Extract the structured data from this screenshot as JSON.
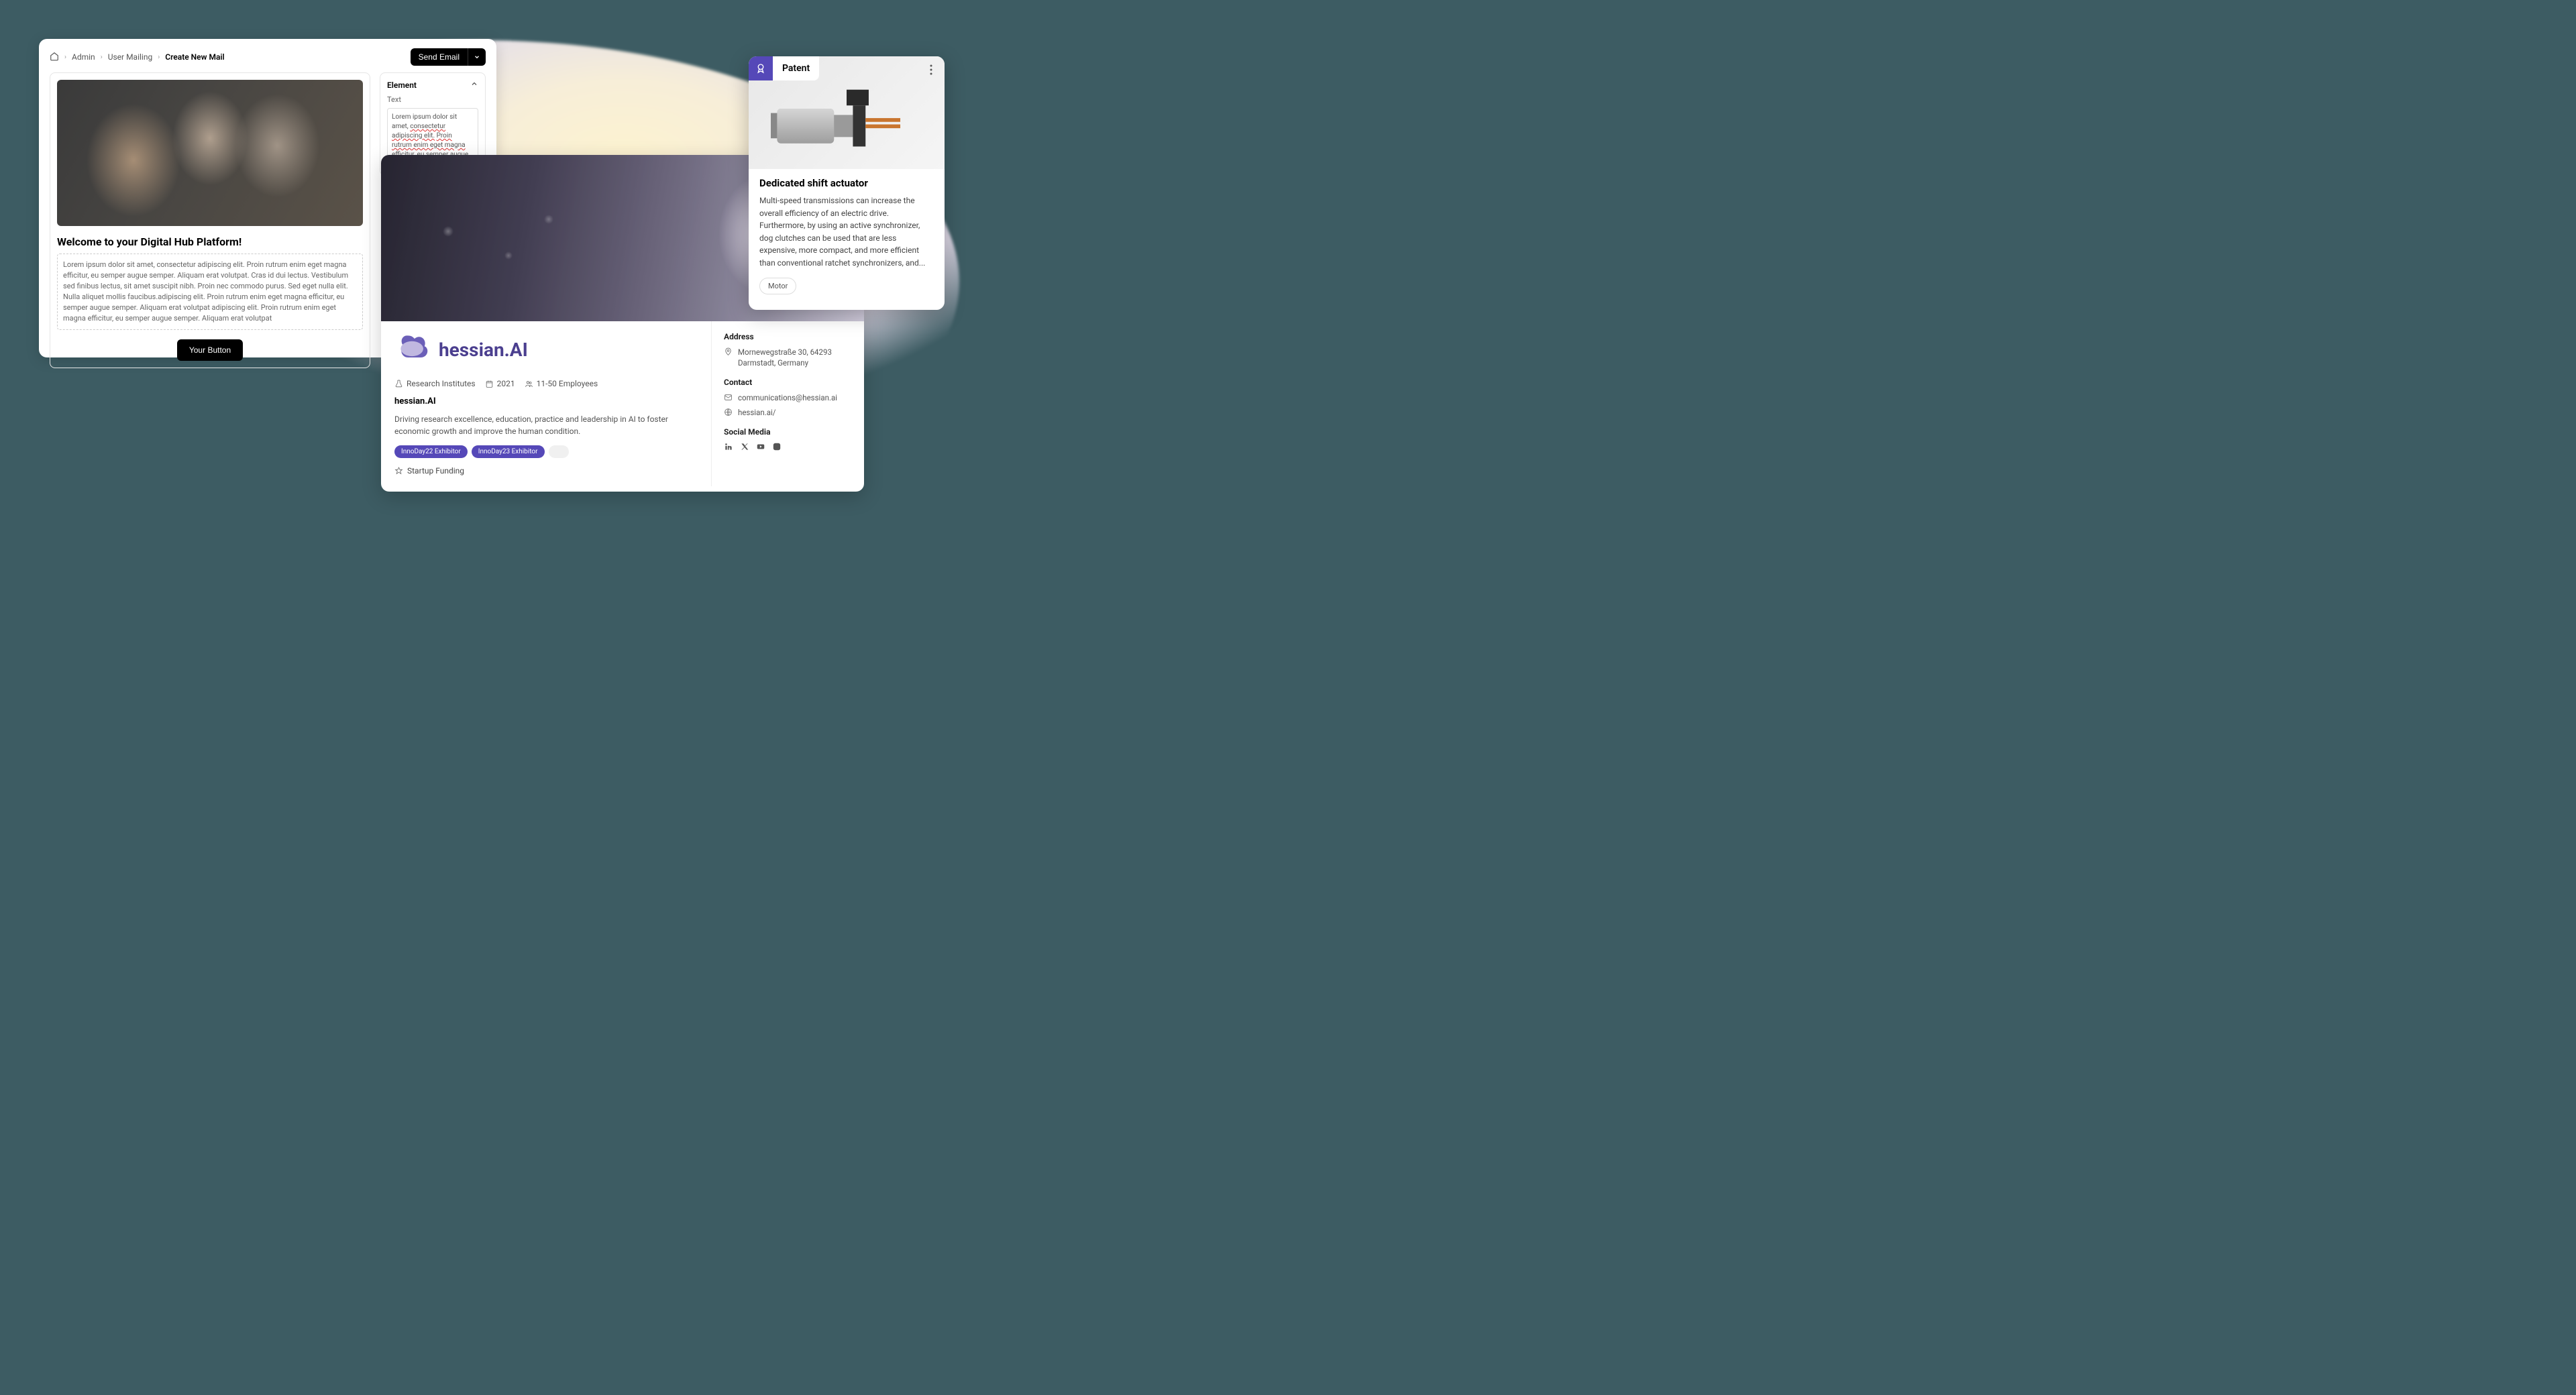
{
  "editor": {
    "breadcrumb": {
      "items": [
        "Admin",
        "User Mailing"
      ],
      "current": "Create New Mail"
    },
    "send_label": "Send Email",
    "heading": "Welcome to your Digital Hub Platform!",
    "body_text": "Lorem ipsum dolor sit amet, consectetur adipiscing elit. Proin rutrum enim eget magna efficitur, eu semper augue semper. Aliquam erat volutpat. Cras id dui lectus. Vestibulum sed finibus lectus, sit amet suscipit nibh. Proin nec commodo purus. Sed eget nulla elit. Nulla aliquet mollis faucibus.adipiscing elit. Proin rutrum enim eget magna efficitur, eu semper augue semper. Aliquam erat volutpat adipiscing elit. Proin rutrum enim eget magna efficitur, eu semper augue semper. Aliquam erat volutpat",
    "cta_label": "Your Button",
    "side": {
      "panel_title": "Element",
      "text_label": "Text",
      "text_value": "Lorem ipsum dolor sit amet, consectetur adipiscing elit. Proin rutrum enim eget magna efficitur, eu semper augue semper. Aliquam erat volutpat."
    }
  },
  "profile": {
    "brand": "hessian.AI",
    "meta": {
      "category": "Research Institutes",
      "year": "2021",
      "employees": "11-50 Employees"
    },
    "name": "hessian.AI",
    "description": "Driving research excellence, education, practice and leadership in AI to foster economic growth and improve the human condition.",
    "badges": [
      "InnoDay22 Exhibitor",
      "InnoDay23 Exhibitor"
    ],
    "funding_label": "Startup Funding",
    "sidebar": {
      "address_head": "Address",
      "address": "Mornewegstraße 30, 64293 Darmstadt, Germany",
      "contact_head": "Contact",
      "email": "communications@hessian.ai",
      "website": "hessian.ai/",
      "social_head": "Social Media"
    }
  },
  "patent": {
    "badge_label": "Patent",
    "title": "Dedicated shift actuator",
    "description": "Multi-speed transmissions can increase the overall efficiency of an electric drive. Furthermore, by using an active synchronizer, dog clutches can be used that are less expensive, more compact, and more efficient than conventional ratchet synchronizers, and...",
    "tag": "Motor"
  }
}
